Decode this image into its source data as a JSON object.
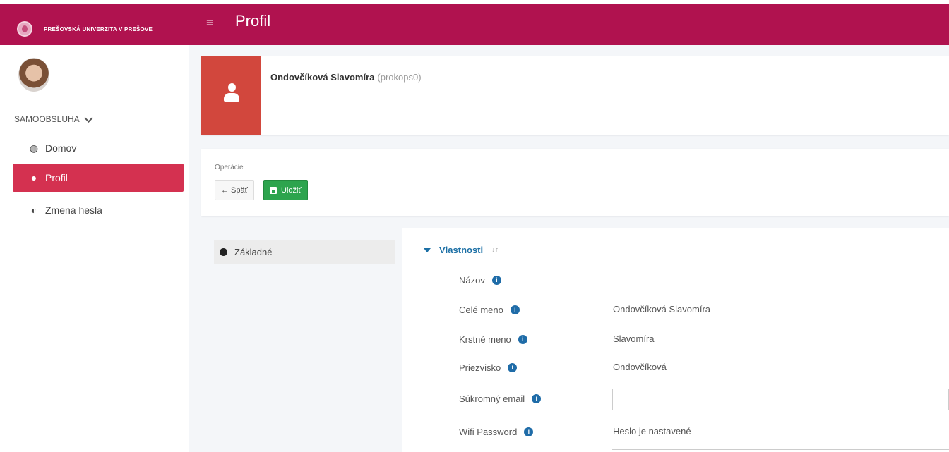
{
  "header": {
    "university": "PREŠOVSKÁ UNIVERZITA V PREŠOVE",
    "menu_icon": "≡",
    "title": "Profil"
  },
  "sidebar": {
    "section_label": "SAMOOBSLUHA",
    "items": [
      {
        "label": "Domov",
        "icon": "dashboard-icon",
        "active": false
      },
      {
        "label": "Profil",
        "icon": "user-icon",
        "active": true
      },
      {
        "label": "Zmena hesla",
        "icon": "shield-icon",
        "active": false
      }
    ]
  },
  "profile": {
    "name": "Ondovčíková Slavomíra",
    "login": "(prokops0)"
  },
  "operations": {
    "label": "Operácie",
    "back_label": "← Späť",
    "save_label": "Uložiť"
  },
  "sections": {
    "nav": [
      "Základné"
    ],
    "group_title": "Vlastnosti",
    "sort_glyph": "↓↑"
  },
  "fields": [
    {
      "label": "Názov",
      "value": ""
    },
    {
      "label": "Celé meno",
      "value": "Ondovčíková Slavomíra"
    },
    {
      "label": "Krstné meno",
      "value": "Slavomíra"
    },
    {
      "label": "Priezvisko",
      "value": "Ondovčíková"
    },
    {
      "label": "Súkromný email",
      "value": "",
      "input": true
    },
    {
      "label": "Wifi Password",
      "value": "Heslo je nastavené"
    }
  ],
  "colors": {
    "topbar": "#b0124f",
    "active_nav": "#d43150",
    "photo_bg": "#d2473d",
    "save_button": "#2da44e",
    "info_icon": "#1f6ca8"
  }
}
